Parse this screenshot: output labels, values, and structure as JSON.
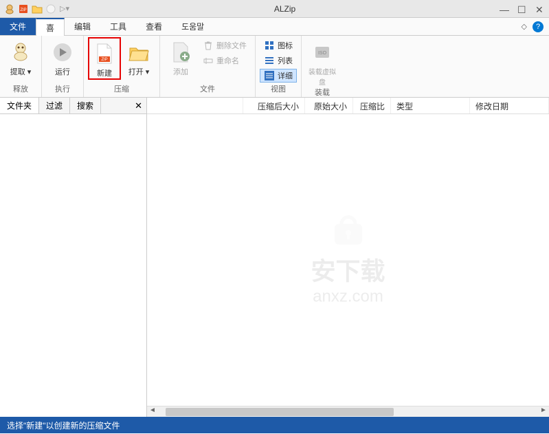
{
  "titlebar": {
    "title": "ALZip"
  },
  "menus": {
    "file": "文件",
    "home": "喜",
    "edit": "编辑",
    "tools": "工具",
    "view": "查看",
    "help": "도움말"
  },
  "ribbon": {
    "extract": {
      "label": "提取",
      "group": "释放"
    },
    "run": {
      "label": "运行",
      "group": "执行"
    },
    "new": {
      "label": "新建"
    },
    "open": {
      "label": "打开",
      "group": "压缩"
    },
    "add": {
      "label": "添加"
    },
    "delete": {
      "label": "删除文件"
    },
    "rename": {
      "label": "重命名",
      "group": "文件"
    },
    "icons": {
      "label": "图标"
    },
    "list": {
      "label": "列表"
    },
    "details": {
      "label": "详细",
      "group": "视图"
    },
    "mount": {
      "label": "装载虚拟盘",
      "group": "装载"
    }
  },
  "sidebar": {
    "tabs": {
      "folder": "文件夹",
      "filter": "过滤",
      "search": "搜索"
    }
  },
  "columns": {
    "name": "",
    "compressed": "压缩后大小",
    "original": "原始大小",
    "ratio": "压缩比",
    "type": "类型",
    "modified": "修改日期"
  },
  "watermark": {
    "top": "安下载",
    "bottom": "anxz.com"
  },
  "status": "选择\"新建\"以创建新的压缩文件"
}
